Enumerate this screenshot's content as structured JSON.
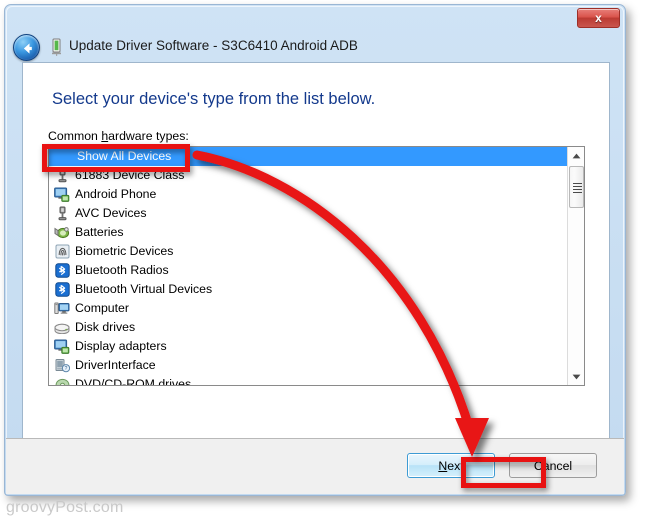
{
  "window": {
    "title": "Update Driver Software - S3C6410 Android ADB",
    "close_label": "x",
    "back_icon": "back-arrow-icon",
    "title_icon": "device-icon"
  },
  "content": {
    "heading": "Select your device's type from the list below.",
    "list_label_pre": "Common ",
    "list_label_accel": "h",
    "list_label_post": "ardware types:"
  },
  "list": {
    "items": [
      {
        "label": "Show All Devices",
        "icon": "none",
        "selected": true
      },
      {
        "label": "61883 Device Class",
        "icon": "usb-icon",
        "selected": false
      },
      {
        "label": "Android Phone",
        "icon": "monitor-icon",
        "selected": false
      },
      {
        "label": "AVC Devices",
        "icon": "usb-icon",
        "selected": false
      },
      {
        "label": "Batteries",
        "icon": "battery-icon",
        "selected": false
      },
      {
        "label": "Biometric Devices",
        "icon": "fingerprint-icon",
        "selected": false
      },
      {
        "label": "Bluetooth Radios",
        "icon": "bluetooth-icon",
        "selected": false
      },
      {
        "label": "Bluetooth Virtual Devices",
        "icon": "bluetooth-icon",
        "selected": false
      },
      {
        "label": "Computer",
        "icon": "computer-icon",
        "selected": false
      },
      {
        "label": "Disk drives",
        "icon": "disk-icon",
        "selected": false
      },
      {
        "label": "Display adapters",
        "icon": "monitor-icon",
        "selected": false
      },
      {
        "label": "DriverInterface",
        "icon": "driver-icon",
        "selected": false
      },
      {
        "label": "DVD/CD-ROM drives",
        "icon": "disc-icon",
        "selected": false
      }
    ],
    "scrollbar": {
      "up_arrow": "▲",
      "down_arrow": "▼"
    }
  },
  "footer": {
    "next_accel": "N",
    "next_rest": "ext",
    "cancel_label": "Cancel"
  },
  "annotations": {
    "highlight_color": "#e81212",
    "selection_color": "#3399ff"
  },
  "watermark": "groovyPost.com"
}
